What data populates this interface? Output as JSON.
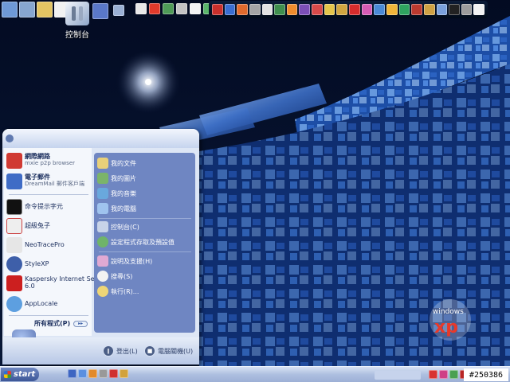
{
  "desktop": {
    "control_panel_label": "控制台",
    "xp_badge_text": "windows xp"
  },
  "start_menu": {
    "left_items": [
      {
        "title": "網際網路",
        "subtitle": "mxie p2p browser"
      },
      {
        "title": "電子郵件",
        "subtitle": "DreamMail 郵件客戶端"
      },
      {
        "title": "命令提示字元",
        "subtitle": ""
      },
      {
        "title": "超級兔子",
        "subtitle": ""
      },
      {
        "title": "NeoTracePro",
        "subtitle": ""
      },
      {
        "title": "StyleXP",
        "subtitle": ""
      },
      {
        "title": "Kaspersky Internet Security",
        "subtitle": "6.0"
      },
      {
        "title": "AppLocale",
        "subtitle": ""
      }
    ],
    "all_programs": "所有程式(P)",
    "right_items": [
      "我的文件",
      "我的圖片",
      "我的音樂",
      "我的電腦",
      "控制台(C)",
      "設定程式存取及預設值",
      "說明及支援(H)",
      "搜尋(S)",
      "執行(R)..."
    ],
    "logoff_label": "登出(L)",
    "shutdown_label": "電腦關機(U)"
  },
  "taskbar": {
    "start_label": "start",
    "clock_text": "#250386"
  },
  "colors": {
    "start_menu_right_panel": "#6f86c2",
    "taskbar": "#aebfe0",
    "start_button": "#3d5797"
  }
}
